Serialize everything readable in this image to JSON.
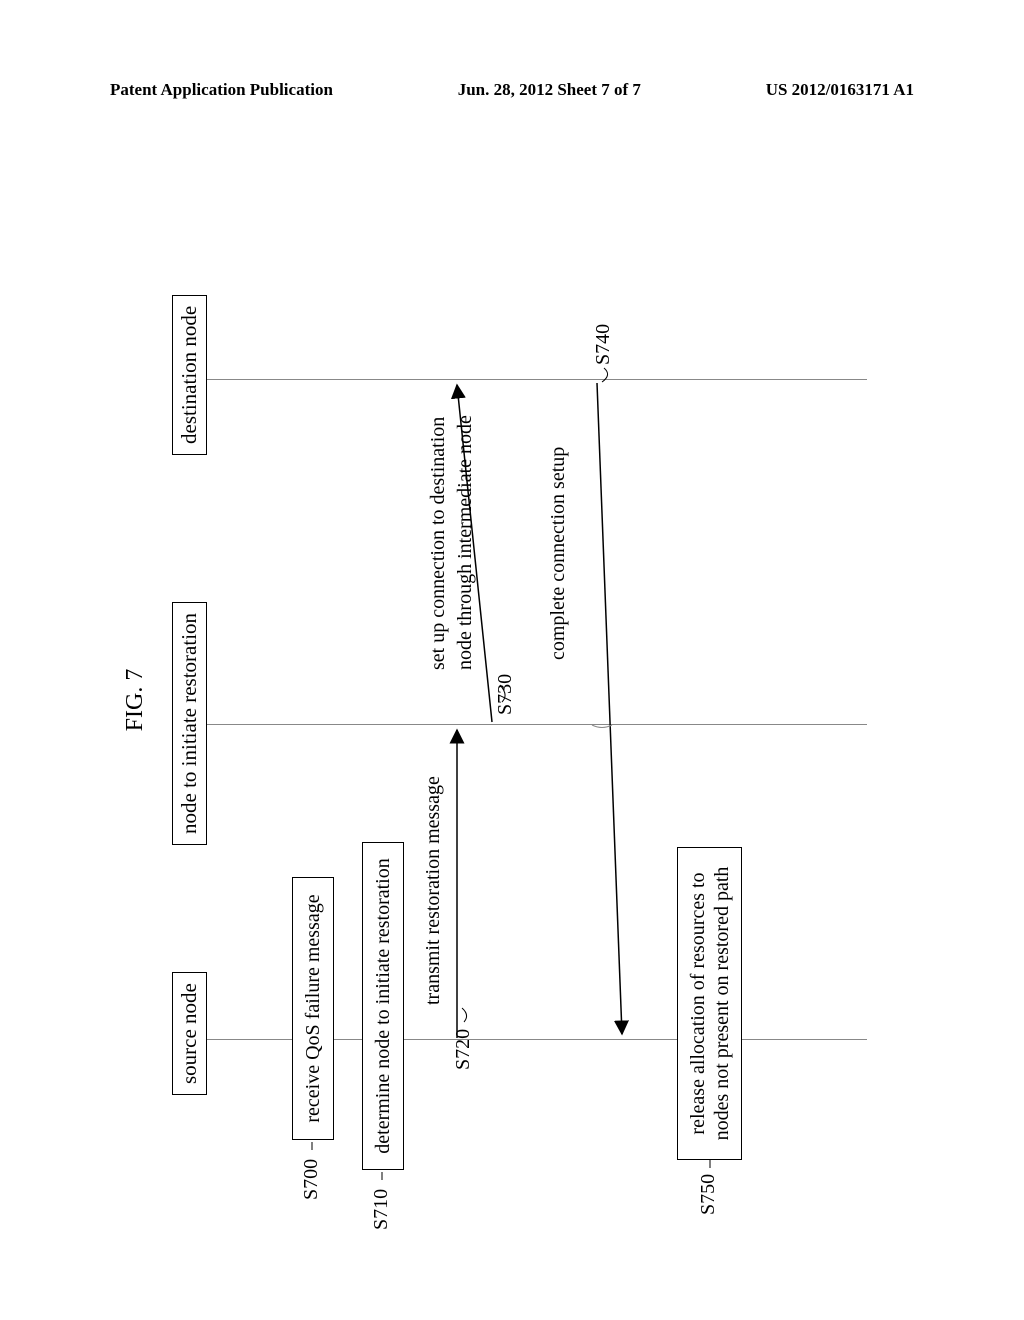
{
  "header": {
    "left": "Patent Application Publication",
    "center": "Jun. 28, 2012  Sheet 7 of 7",
    "right": "US 2012/0163171 A1"
  },
  "figure": {
    "title": "FIG. 7",
    "lanes": {
      "source": "source node",
      "initiator": "node to initiate restoration",
      "destination": "destination node"
    },
    "steps": {
      "s700": {
        "tag": "S700",
        "text": "receive QoS failure message"
      },
      "s710": {
        "tag": "S710",
        "text": "determine node to initiate restoration"
      },
      "s720": {
        "tag": "S720",
        "text": "transmit restoration message"
      },
      "s730": {
        "tag": "S730",
        "text1": "set up connection to destination",
        "text2": "node through intermediate node"
      },
      "s740": {
        "tag": "S740",
        "text": "complete connection setup"
      },
      "s750": {
        "tag": "S750",
        "text1": "release allocation of resources to",
        "text2": "nodes not present on restored path"
      }
    }
  }
}
